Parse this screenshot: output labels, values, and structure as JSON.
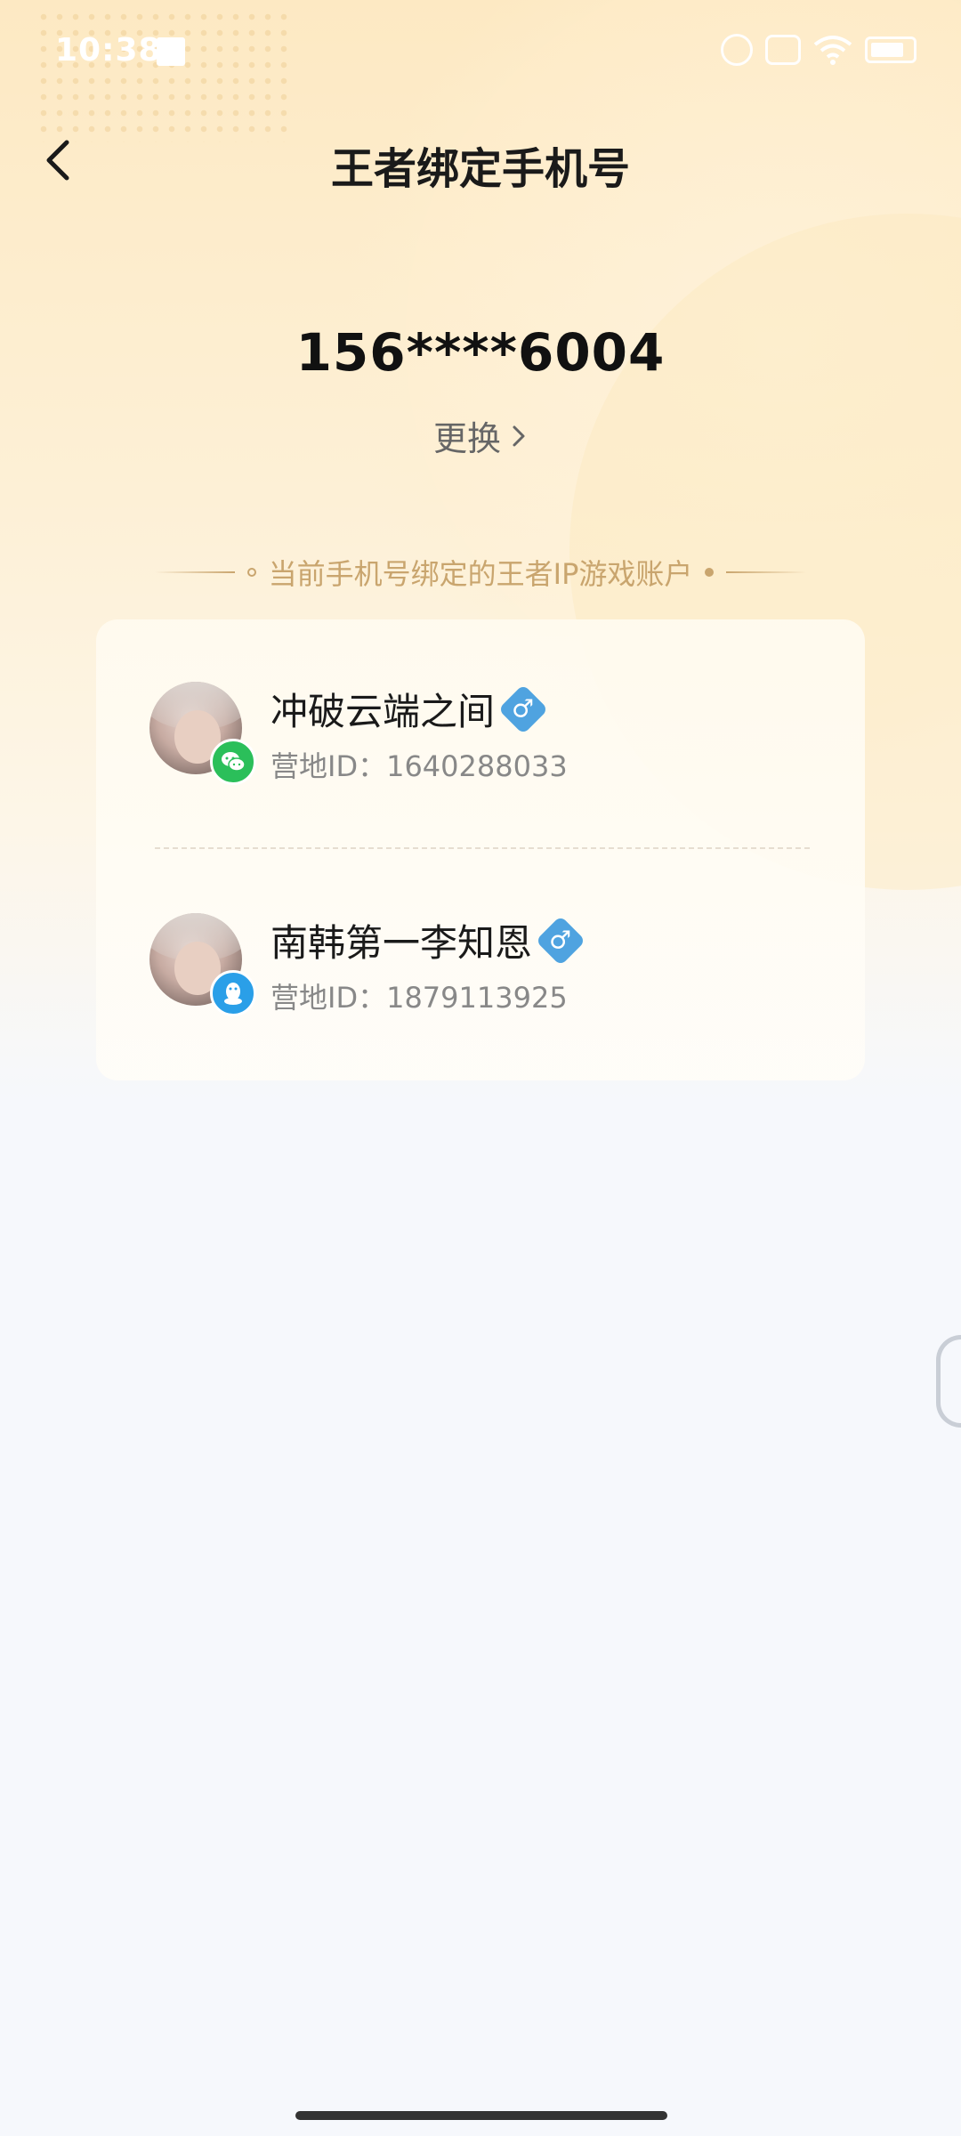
{
  "status_bar": {
    "time": "10:38"
  },
  "header": {
    "title": "王者绑定手机号"
  },
  "phone": {
    "number": "156****6004",
    "change_label": "更换"
  },
  "section": {
    "label": "当前手机号绑定的王者IP游戏账户"
  },
  "accounts": [
    {
      "name": "冲破云端之间",
      "id_text": "营地ID：1640288033",
      "platform": "wechat-icon",
      "gender": "♂"
    },
    {
      "name": "南韩第一李知恩",
      "id_text": "营地ID：1879113925",
      "platform": "qq-icon",
      "gender": "♂"
    }
  ],
  "colors": {
    "accent_gold": "#c9a56e",
    "wechat": "#2bbf5a",
    "qq": "#2a9fe8",
    "gender_male": "#4fa3e0"
  }
}
